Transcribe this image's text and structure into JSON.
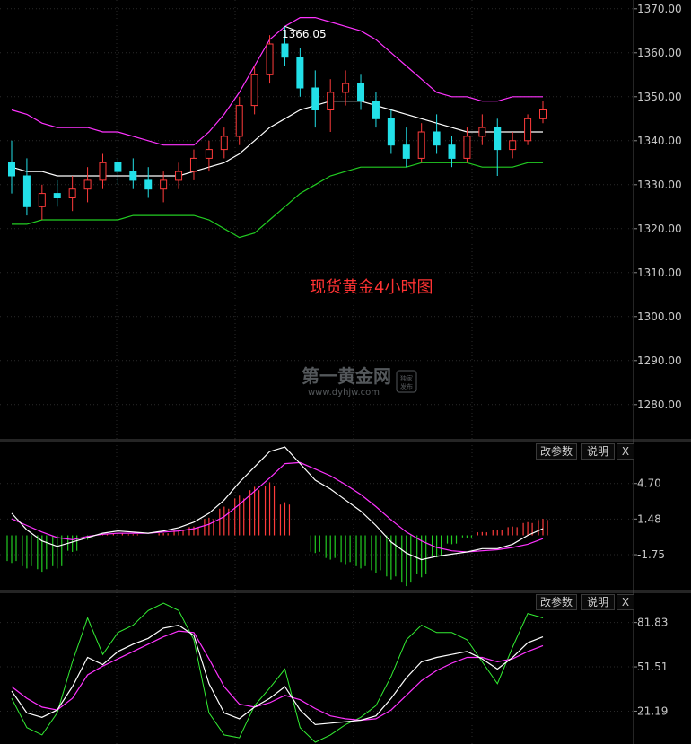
{
  "chart_data": [
    {
      "type": "candlestick",
      "title": "现货黄金4小时图",
      "watermark": "第一黄金网",
      "watermark_url": "www.dyhjw.com",
      "watermark_badge": "独家发布",
      "peak_annotation": "1366.05",
      "yticks": [
        "1370.00",
        "1360.00",
        "1350.00",
        "1340.00",
        "1330.00",
        "1320.00",
        "1310.00",
        "1300.00",
        "1290.00",
        "1280.00"
      ],
      "ylim": [
        1272,
        1372
      ],
      "colors": {
        "up": "#ff3b3b",
        "down": "#22e0e8",
        "mid": "#ffffff",
        "upper": "#ff33ff",
        "lower": "#22cc22"
      },
      "candles": [
        [
          1335,
          1340,
          1328,
          1332
        ],
        [
          1332,
          1336,
          1323,
          1325
        ],
        [
          1325,
          1330,
          1322,
          1328
        ],
        [
          1328,
          1331,
          1325,
          1327
        ],
        [
          1327,
          1332,
          1324,
          1329
        ],
        [
          1329,
          1334,
          1326,
          1331
        ],
        [
          1331,
          1337,
          1329,
          1335
        ],
        [
          1335,
          1336,
          1330,
          1333
        ],
        [
          1333,
          1336,
          1329,
          1331
        ],
        [
          1331,
          1334,
          1327,
          1329
        ],
        [
          1329,
          1333,
          1326,
          1331
        ],
        [
          1331,
          1335,
          1329,
          1333
        ],
        [
          1333,
          1338,
          1331,
          1336
        ],
        [
          1336,
          1340,
          1333,
          1338
        ],
        [
          1338,
          1343,
          1336,
          1341
        ],
        [
          1341,
          1350,
          1339,
          1348
        ],
        [
          1348,
          1357,
          1346,
          1355
        ],
        [
          1355,
          1364,
          1353,
          1362
        ],
        [
          1362,
          1366,
          1357,
          1359
        ],
        [
          1359,
          1361,
          1350,
          1352
        ],
        [
          1352,
          1356,
          1343,
          1347
        ],
        [
          1347,
          1354,
          1342,
          1351
        ],
        [
          1351,
          1356,
          1348,
          1353
        ],
        [
          1353,
          1355,
          1347,
          1349
        ],
        [
          1349,
          1351,
          1343,
          1345
        ],
        [
          1345,
          1347,
          1337,
          1339
        ],
        [
          1339,
          1343,
          1334,
          1336
        ],
        [
          1336,
          1344,
          1335,
          1342
        ],
        [
          1342,
          1346,
          1337,
          1339
        ],
        [
          1339,
          1341,
          1334,
          1336
        ],
        [
          1336,
          1343,
          1335,
          1341
        ],
        [
          1341,
          1346,
          1339,
          1343
        ],
        [
          1343,
          1345,
          1332,
          1338
        ],
        [
          1338,
          1342,
          1336,
          1340
        ],
        [
          1340,
          1346,
          1339,
          1345
        ],
        [
          1345,
          1349,
          1344,
          1347
        ]
      ],
      "bb_mid": [
        1334,
        1333,
        1333,
        1332,
        1332,
        1332,
        1332,
        1332,
        1332,
        1332,
        1332,
        1332,
        1333,
        1334,
        1335,
        1337,
        1340,
        1343,
        1345,
        1347,
        1348,
        1349,
        1349,
        1349,
        1348,
        1347,
        1346,
        1345,
        1344,
        1343,
        1342,
        1342,
        1342,
        1342,
        1342,
        1342
      ],
      "bb_upper": [
        1347,
        1346,
        1344,
        1343,
        1343,
        1343,
        1342,
        1342,
        1341,
        1340,
        1339,
        1339,
        1339,
        1342,
        1346,
        1351,
        1357,
        1363,
        1366,
        1368,
        1368,
        1367,
        1366,
        1365,
        1363,
        1360,
        1357,
        1354,
        1351,
        1350,
        1350,
        1349,
        1349,
        1350,
        1350,
        1350
      ],
      "bb_lower": [
        1321,
        1321,
        1322,
        1322,
        1322,
        1322,
        1322,
        1322,
        1323,
        1323,
        1323,
        1323,
        1323,
        1322,
        1320,
        1318,
        1319,
        1322,
        1325,
        1328,
        1330,
        1332,
        1333,
        1334,
        1334,
        1334,
        1334,
        1335,
        1335,
        1335,
        1335,
        1334,
        1334,
        1334,
        1335,
        1335
      ]
    },
    {
      "type": "macd",
      "buttons": [
        "改参数",
        "说明",
        "X"
      ],
      "yticks": [
        "4.70",
        "1.48",
        "-1.75"
      ],
      "ylim": [
        -5.0,
        8.5
      ],
      "hist_colors": {
        "pos": "#ff3b3b",
        "neg": "#22cc22"
      },
      "dif": [
        2.0,
        0.5,
        -0.5,
        -1.0,
        -0.6,
        -0.2,
        0.2,
        0.4,
        0.3,
        0.2,
        0.4,
        0.7,
        1.2,
        2.0,
        3.2,
        4.8,
        6.2,
        7.6,
        8.0,
        6.5,
        5.0,
        4.2,
        3.2,
        2.2,
        0.9,
        -0.6,
        -1.6,
        -2.2,
        -1.9,
        -1.7,
        -1.5,
        -1.2,
        -1.2,
        -0.8,
        0.0,
        0.6
      ],
      "dea": [
        1.5,
        0.9,
        0.3,
        -0.2,
        -0.4,
        -0.1,
        0.1,
        0.2,
        0.2,
        0.2,
        0.3,
        0.4,
        0.6,
        1.0,
        1.7,
        2.8,
        4.0,
        5.2,
        6.5,
        6.6,
        6.0,
        5.4,
        4.6,
        3.7,
        2.6,
        1.4,
        0.3,
        -0.5,
        -1.1,
        -1.4,
        -1.5,
        -1.4,
        -1.3,
        -1.1,
        -0.8,
        -0.3
      ],
      "hist": [
        -2.5,
        -3.0,
        -3.3,
        -3.0,
        -1.5,
        -0.4,
        0.1,
        0.2,
        0.1,
        0.0,
        0.2,
        0.5,
        0.8,
        1.6,
        2.6,
        3.6,
        4.4,
        4.8,
        3.0,
        0.0,
        -1.6,
        -2.2,
        -2.6,
        -3.0,
        -3.4,
        -4.0,
        -4.6,
        -3.8,
        -2.0,
        -0.8,
        -0.2,
        0.3,
        0.5,
        0.8,
        1.2,
        1.5
      ]
    },
    {
      "type": "kdj",
      "buttons": [
        "改参数",
        "说明",
        "X"
      ],
      "yticks": [
        "81.83",
        "51.51",
        "21.19"
      ],
      "ylim": [
        0,
        100
      ],
      "k": [
        35,
        20,
        17,
        22,
        38,
        58,
        53,
        62,
        67,
        71,
        78,
        80,
        73,
        40,
        20,
        16,
        24,
        30,
        38,
        22,
        12,
        13,
        14,
        15,
        18,
        30,
        44,
        55,
        58,
        60,
        62,
        57,
        50,
        58,
        68,
        72
      ],
      "d": [
        38,
        30,
        24,
        22,
        30,
        46,
        52,
        57,
        62,
        67,
        72,
        76,
        75,
        57,
        38,
        26,
        24,
        27,
        32,
        29,
        23,
        18,
        16,
        15,
        16,
        22,
        32,
        42,
        49,
        54,
        58,
        58,
        55,
        57,
        62,
        66
      ],
      "j": [
        30,
        10,
        5,
        20,
        55,
        85,
        60,
        75,
        80,
        90,
        95,
        90,
        70,
        20,
        5,
        3,
        25,
        37,
        50,
        10,
        0,
        5,
        12,
        17,
        25,
        45,
        70,
        80,
        75,
        75,
        70,
        55,
        40,
        65,
        88,
        85
      ]
    }
  ]
}
